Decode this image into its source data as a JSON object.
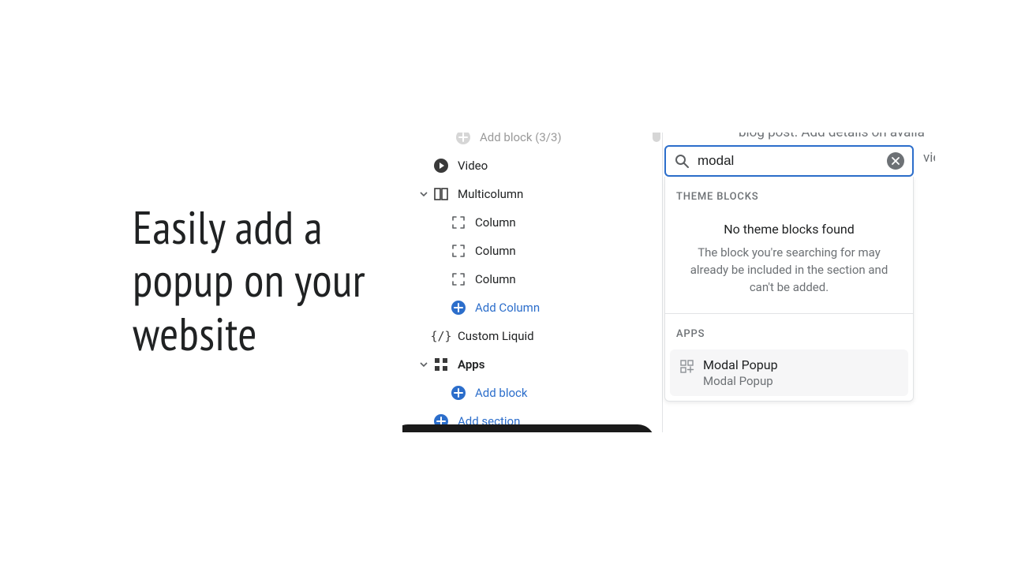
{
  "headline": "Easily add a popup on your website",
  "tree": {
    "add_block_top": "Add block (3/3)",
    "video": "Video",
    "multicolumn": "Multicolumn",
    "columns": [
      "Column",
      "Column",
      "Column"
    ],
    "add_column": "Add Column",
    "custom_liquid": "Custom Liquid",
    "apps": "Apps",
    "add_block": "Add block",
    "add_section": "Add section"
  },
  "popup": {
    "bg_text1": "blog post. Add details on availa",
    "bg_text2": "vie",
    "search_value": "modal",
    "theme_blocks_label": "THEME BLOCKS",
    "empty_title": "No theme blocks found",
    "empty_desc": "The block you're searching for may already be included in the section and can't be added.",
    "apps_label": "APPS",
    "app_title": "Modal Popup",
    "app_sub": "Modal Popup"
  }
}
